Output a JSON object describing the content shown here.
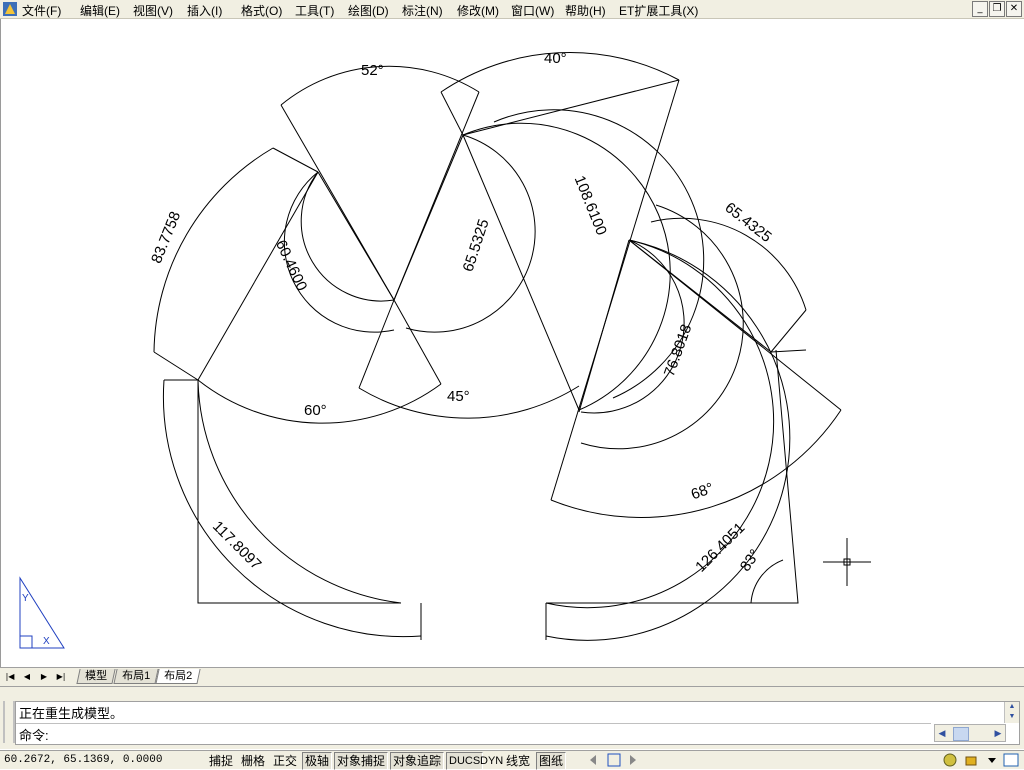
{
  "menubar": {
    "items": [
      "文件(F)",
      "编辑(E)",
      "视图(V)",
      "插入(I)",
      "格式(O)",
      "工具(T)",
      "绘图(D)",
      "标注(N)",
      "修改(M)",
      "窗口(W)",
      "帮助(H)",
      "ET扩展工具(X)"
    ]
  },
  "window_controls": {
    "minimize": "_",
    "restore": "❐",
    "close": "✕"
  },
  "drawing": {
    "angles": [
      "52°",
      "40°",
      "60°",
      "45°",
      "68°",
      "83°"
    ],
    "radii": [
      "83.7758",
      "60.4600",
      "65.5325",
      "108.6100",
      "65.4325",
      "76.8018",
      "117.8097",
      "126.4051"
    ],
    "ucs": {
      "y_label": "Y",
      "x_label": "X"
    }
  },
  "layout_tabs": {
    "nav": [
      "|◀",
      "◀",
      "▶",
      "▶|"
    ],
    "tabs": [
      "模型",
      "布局1",
      "布局2"
    ],
    "active": "布局2"
  },
  "command": {
    "history": "正在重生成模型。",
    "prompt": "命令:"
  },
  "status": {
    "coordinates": "60.2672, 65.1369, 0.0000",
    "toggles": [
      "捕捉",
      "栅格",
      "正交",
      "极轴",
      "对象捕捉",
      "对象追踪",
      "DUCS",
      "DYN",
      "线宽",
      "图纸"
    ],
    "pressed": [
      "极轴",
      "对象捕捉",
      "对象追踪",
      "DUCS",
      "图纸"
    ]
  }
}
